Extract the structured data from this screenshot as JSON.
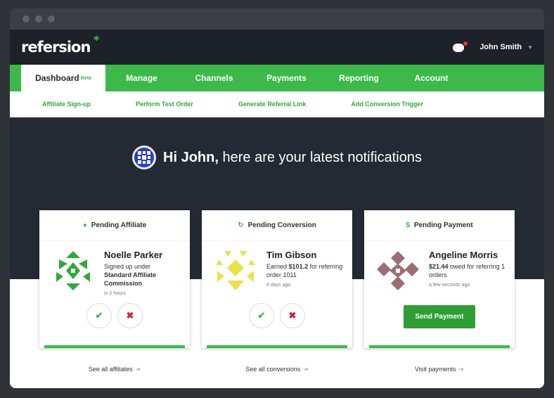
{
  "app": {
    "logo": "refersion",
    "logo_mark": "*"
  },
  "user": {
    "name": "John Smith"
  },
  "nav": {
    "tabs": [
      {
        "label": "Dashboard",
        "badge": "Beta"
      },
      {
        "label": "Manage"
      },
      {
        "label": "Channels"
      },
      {
        "label": "Payments"
      },
      {
        "label": "Reporting"
      },
      {
        "label": "Account"
      }
    ],
    "sub": [
      "Affiliate Sign-up",
      "Perform Test Order",
      "Generate Referral Link",
      "Add Conversion Trigger"
    ]
  },
  "greeting": {
    "bold": "Hi John,",
    "rest": " here are your latest notifications"
  },
  "cards": [
    {
      "title": "Pending Affiliate",
      "icon": "person-icon",
      "name": "Noelle Parker",
      "desc_1": "Signed up under",
      "desc_bold": "Standard Affiliate Commission",
      "time": "in 2 hours",
      "link": "See all affiliates",
      "color": "#2fa83c"
    },
    {
      "title": "Pending Conversion",
      "icon": "refresh-icon",
      "name": "Tim Gibson",
      "desc_1": "Earned",
      "desc_bold": "$101.2",
      "desc_2": "for referring order 1011",
      "time": "4 days ago",
      "link": "See all conversions",
      "color": "#e9e24a"
    },
    {
      "title": "Pending Payment",
      "icon": "dollar-icon",
      "name": "Angeline Morris",
      "desc_bold": "$21.44",
      "desc_2": "owed for referring 1 orders",
      "time": "a few seconds ago",
      "button": "Send Payment",
      "link": "Visit payments",
      "color": "#9b6e75"
    }
  ]
}
